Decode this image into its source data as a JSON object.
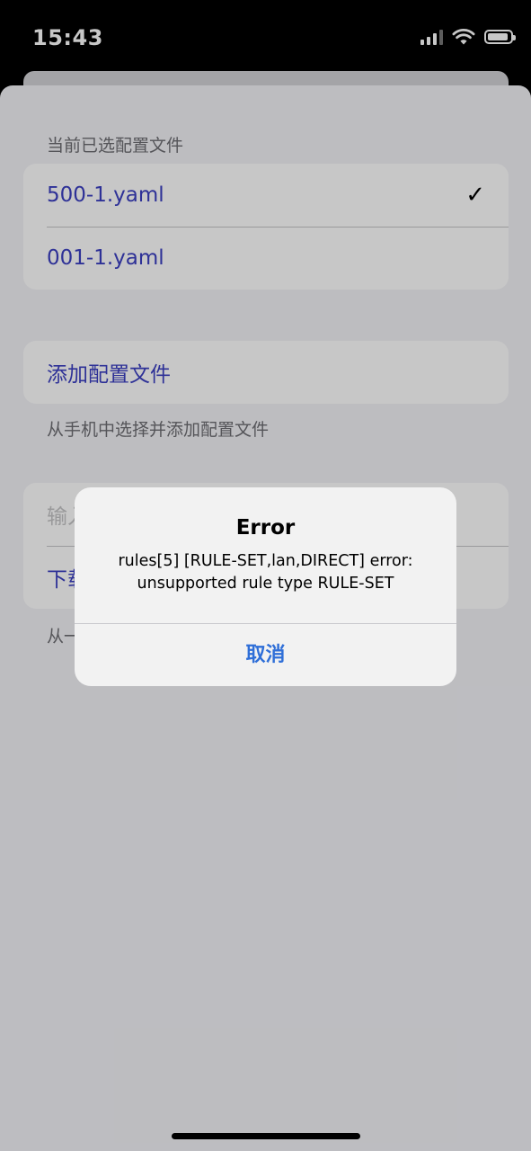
{
  "status_bar": {
    "time": "15:43"
  },
  "profiles": {
    "section_label": "当前已选配置文件",
    "items": [
      {
        "label": "500-1.yaml",
        "selected": true
      },
      {
        "label": "001-1.yaml",
        "selected": false
      }
    ],
    "check_glyph": "✓"
  },
  "add_profile": {
    "button_label": "添加配置文件",
    "footer": "从手机中选择并添加配置文件"
  },
  "download": {
    "input_placeholder": "输入",
    "button_label": "下载",
    "footer": "从一"
  },
  "alert": {
    "title": "Error",
    "message_line1": "rules[5] [RULE-SET,lan,DIRECT] error:",
    "message_line2": "unsupported rule type RULE-SET",
    "button_label": "取消"
  },
  "colors": {
    "link": "#3b3fc2",
    "alert_button": "#2f6fd8"
  }
}
